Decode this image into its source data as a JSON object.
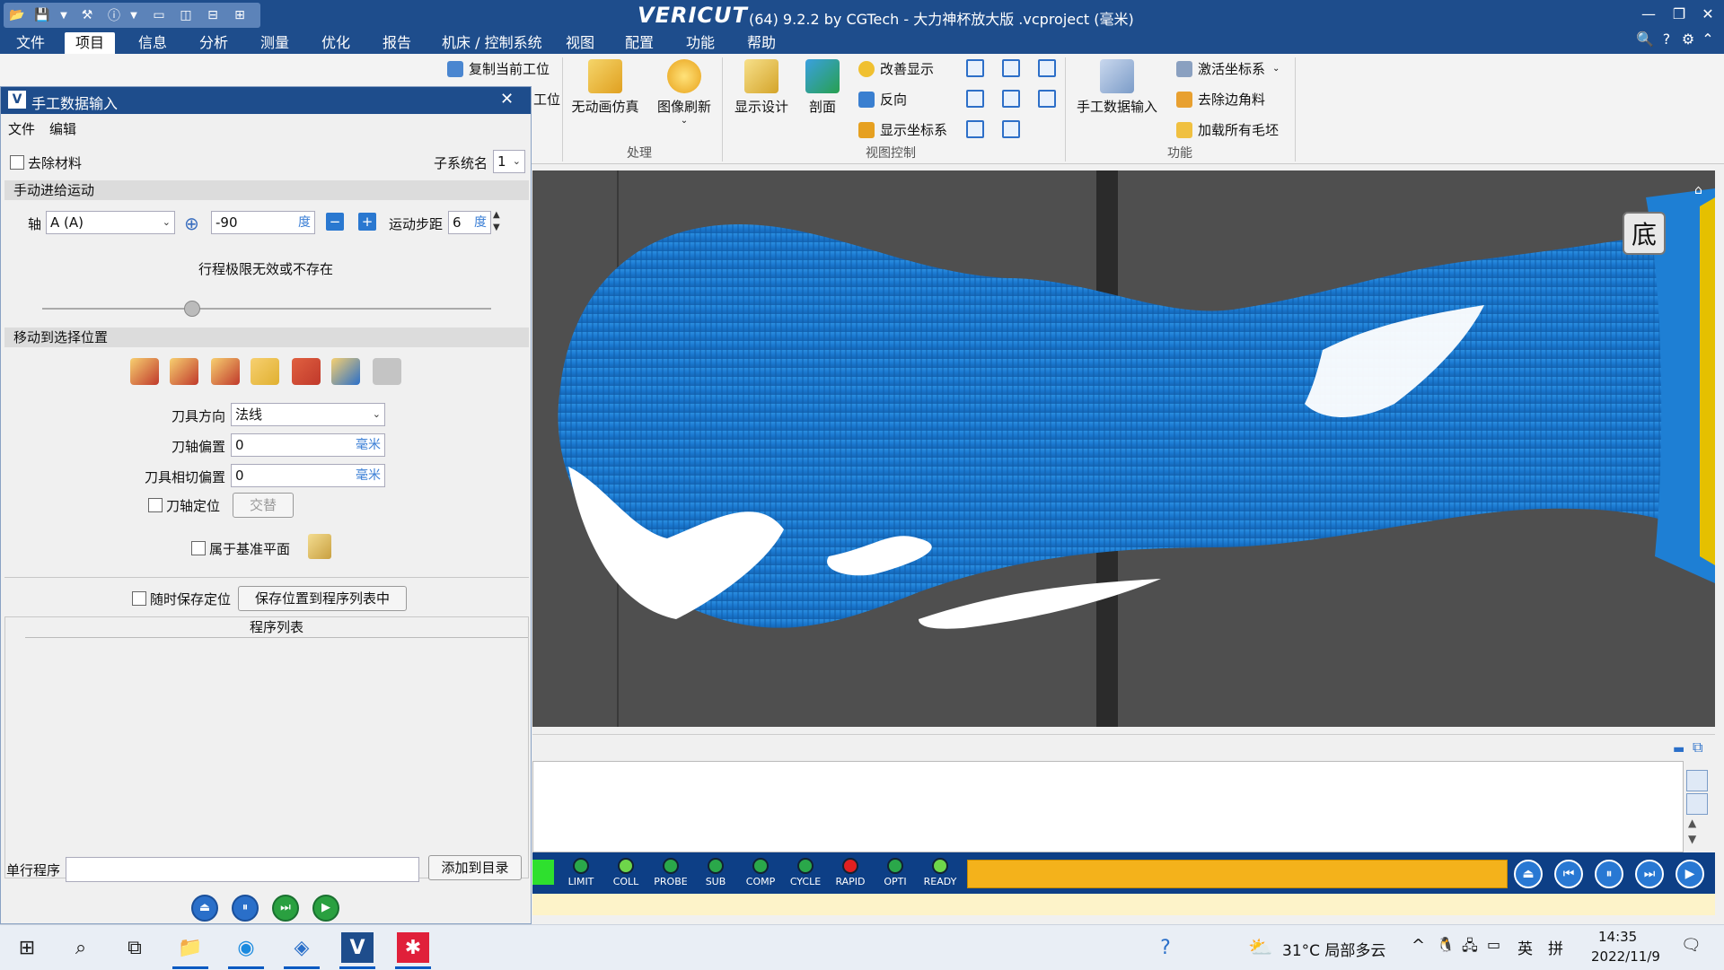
{
  "window": {
    "logo": "VERICUT",
    "title": "(64) 9.2.2 by CGTech - 大力神杯放大版 .vcproject (毫米)"
  },
  "menu": [
    "文件",
    "项目",
    "信息",
    "分析",
    "测量",
    "优化",
    "报告",
    "机床 / 控制系统",
    "视图",
    "配置",
    "功能",
    "帮助"
  ],
  "ribbon": {
    "copy_position": "复制当前工位",
    "position_cut": "工位",
    "no_anim": "无动画仿真",
    "refresh": "图像刷新",
    "group_process": "处理",
    "show_design": "显示设计",
    "section": "剖面",
    "improve_display": "改善显示",
    "reverse": "反向",
    "show_csys": "显示坐标系",
    "group_view": "视图控制",
    "mdi": "手工数据输入",
    "activate_csys": "激活坐标系",
    "remove_chamfer": "去除边角料",
    "load_stock": "加载所有毛坯",
    "group_function": "功能"
  },
  "dialog": {
    "title": "手工数据输入",
    "menu_file": "文件",
    "menu_edit": "编辑",
    "remove_material": "去除材料",
    "subsystem_label": "子系统名",
    "subsystem_value": "1",
    "section_jog": "手动进给运动",
    "axis_label": "轴",
    "axis_value": "A (A)",
    "angle_value": "-90",
    "angle_unit": "度",
    "step_label": "运动步距",
    "step_value": "6",
    "step_unit": "度",
    "travel_msg": "行程极限无效或不存在",
    "section_move": "移动到选择位置",
    "tool_dir_label": "刀具方向",
    "tool_dir_value": "法线",
    "axis_offset_label": "刀轴偏置",
    "axis_offset_value": "0",
    "axis_offset_unit": "毫米",
    "tangent_offset_label": "刀具相切偏置",
    "tangent_offset_value": "0",
    "tangent_offset_unit": "毫米",
    "axis_locate": "刀轴定位",
    "alternate": "交替",
    "belongs_base": "属于基准平面",
    "save_always": "随时保存定位",
    "save_to_list": "保存位置到程序列表中",
    "program_list": "程序列表",
    "single_program": "单行程序",
    "add_to_list": "添加到目录"
  },
  "viewport": {
    "view_cube_label": "底"
  },
  "status_leds": [
    {
      "label": "LIMIT",
      "color": "#2aa84a"
    },
    {
      "label": "COLL",
      "color": "#6ed64a"
    },
    {
      "label": "PROBE",
      "color": "#2aa84a"
    },
    {
      "label": "SUB",
      "color": "#2aa84a"
    },
    {
      "label": "COMP",
      "color": "#2aa84a"
    },
    {
      "label": "CYCLE",
      "color": "#2aa84a"
    },
    {
      "label": "RAPID",
      "color": "#e02020"
    },
    {
      "label": "OPTI",
      "color": "#2aa84a"
    },
    {
      "label": "READY",
      "color": "#6ed64a"
    }
  ],
  "taskbar": {
    "weather": "31°C 局部多云",
    "ime": "英",
    "ime2": "拼",
    "time": "14:35",
    "date": "2022/11/9"
  }
}
